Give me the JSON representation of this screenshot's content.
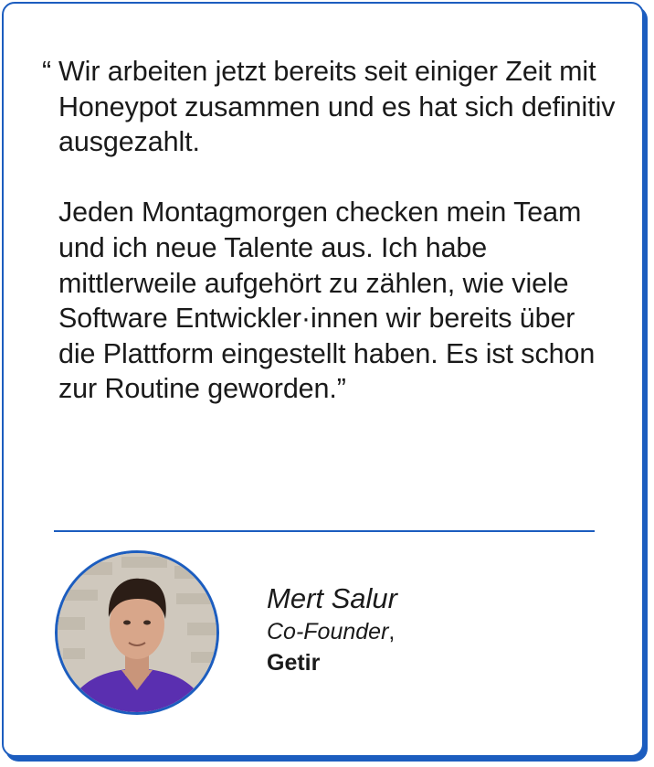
{
  "testimonial": {
    "open_quote": "“",
    "paragraph_1": "Wir arbeiten jetzt bereits seit einiger Zeit mit Honeypot zusammen und es hat sich definitiv ausgezahlt.",
    "paragraph_2": "Jeden Montagmorgen checken mein Team und ich neue Talente aus. Ich habe mittlerweile aufgehört zu zählen, wie viele Software Entwickler·innen wir bereits über die Plattform eingestellt haben. Es ist schon zur Routine geworden.",
    "close_quote": "”"
  },
  "author": {
    "name": "Mert Salur",
    "role": "Co-Founder",
    "role_separator": ",",
    "company": "Getir"
  },
  "colors": {
    "accent": "#1c5dbf",
    "text": "#1a1a1a",
    "background": "#ffffff"
  }
}
